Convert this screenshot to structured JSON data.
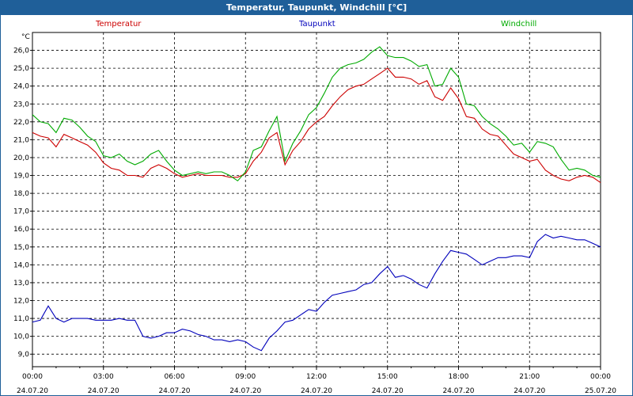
{
  "window": {
    "title": "Temperatur, Taupunkt, Windchill [°C]"
  },
  "legend": [
    {
      "name": "Temperatur",
      "color": "#cc0000"
    },
    {
      "name": "Taupunkt",
      "color": "#0000bb"
    },
    {
      "name": "Windchill",
      "color": "#00aa00"
    }
  ],
  "chart_data": {
    "type": "line",
    "ylabel": "°C",
    "ylim": [
      8.3,
      27.0
    ],
    "xlim_hours": [
      0,
      24
    ],
    "y_ticks": [
      "9,0",
      "10,0",
      "11,0",
      "12,0",
      "13,0",
      "14,0",
      "15,0",
      "16,0",
      "17,0",
      "18,0",
      "19,0",
      "20,0",
      "21,0",
      "22,0",
      "23,0",
      "24,0",
      "25,0",
      "26,0"
    ],
    "y_tick_values": [
      9,
      10,
      11,
      12,
      13,
      14,
      15,
      16,
      17,
      18,
      19,
      20,
      21,
      22,
      23,
      24,
      25,
      26
    ],
    "x_ticks": [
      {
        "time": "00:00",
        "date": "24.07.20"
      },
      {
        "time": "03:00",
        "date": "24.07.20"
      },
      {
        "time": "06:00",
        "date": "24.07.20"
      },
      {
        "time": "09:00",
        "date": "24.07.20"
      },
      {
        "time": "12:00",
        "date": "24.07.20"
      },
      {
        "time": "15:00",
        "date": "24.07.20"
      },
      {
        "time": "18:00",
        "date": "24.07.20"
      },
      {
        "time": "21:00",
        "date": "24.07.20"
      },
      {
        "time": "00:00",
        "date": "25.07.20"
      }
    ],
    "grid": true,
    "series": [
      {
        "name": "Temperatur",
        "color": "#cc0000",
        "x": [
          0,
          0.33,
          0.67,
          1,
          1.33,
          1.67,
          2,
          2.33,
          2.67,
          3,
          3.33,
          3.67,
          4,
          4.33,
          4.67,
          5,
          5.33,
          5.67,
          6,
          6.33,
          6.67,
          7,
          7.33,
          7.67,
          8,
          8.33,
          8.67,
          9,
          9.33,
          9.67,
          10,
          10.33,
          10.67,
          11,
          11.33,
          11.67,
          12,
          12.33,
          12.67,
          13,
          13.33,
          13.67,
          14,
          14.33,
          14.67,
          15,
          15.33,
          15.67,
          16,
          16.33,
          16.67,
          17,
          17.33,
          17.67,
          18,
          18.33,
          18.67,
          19,
          19.33,
          19.67,
          20,
          20.33,
          20.67,
          21,
          21.33,
          21.67,
          22,
          22.33,
          22.67,
          23,
          23.33,
          23.67,
          24
        ],
        "y": [
          21.4,
          21.2,
          21.1,
          20.6,
          21.3,
          21.1,
          20.9,
          20.7,
          20.3,
          19.7,
          19.4,
          19.3,
          19.0,
          19.0,
          18.9,
          19.4,
          19.6,
          19.4,
          19.1,
          18.9,
          19.0,
          19.1,
          19.0,
          19.0,
          19.0,
          18.9,
          18.9,
          19.1,
          19.8,
          20.3,
          21.1,
          21.4,
          19.6,
          20.4,
          20.9,
          21.6,
          22.0,
          22.3,
          22.9,
          23.4,
          23.8,
          24.0,
          24.1,
          24.4,
          24.7,
          25.0,
          24.5,
          24.5,
          24.4,
          24.1,
          24.3,
          23.4,
          23.2,
          23.9,
          23.3,
          22.3,
          22.2,
          21.6,
          21.3,
          21.2,
          20.7,
          20.2,
          20.0,
          19.8,
          19.9,
          19.3,
          19.0,
          18.8,
          18.7,
          18.9,
          19.0,
          18.9,
          18.6
        ]
      },
      {
        "name": "Taupunkt",
        "color": "#0000bb",
        "x": [
          0,
          0.33,
          0.67,
          1,
          1.33,
          1.67,
          2,
          2.33,
          2.67,
          3,
          3.33,
          3.67,
          4,
          4.33,
          4.67,
          5,
          5.33,
          5.67,
          6,
          6.33,
          6.67,
          7,
          7.33,
          7.67,
          8,
          8.33,
          8.67,
          9,
          9.33,
          9.67,
          10,
          10.33,
          10.67,
          11,
          11.33,
          11.67,
          12,
          12.33,
          12.67,
          13,
          13.33,
          13.67,
          14,
          14.33,
          14.67,
          15,
          15.33,
          15.67,
          16,
          16.33,
          16.67,
          17,
          17.33,
          17.67,
          18,
          18.33,
          18.67,
          19,
          19.33,
          19.67,
          20,
          20.33,
          20.67,
          21,
          21.33,
          21.67,
          22,
          22.33,
          22.67,
          23,
          23.33,
          23.67,
          24
        ],
        "y": [
          10.8,
          10.9,
          11.7,
          11.0,
          10.8,
          11.0,
          11.0,
          11.0,
          10.9,
          10.9,
          10.9,
          11.0,
          10.9,
          10.9,
          10.0,
          9.9,
          10.0,
          10.2,
          10.2,
          10.4,
          10.3,
          10.1,
          10.0,
          9.8,
          9.8,
          9.7,
          9.8,
          9.7,
          9.4,
          9.2,
          9.9,
          10.3,
          10.8,
          10.9,
          11.2,
          11.5,
          11.4,
          11.9,
          12.3,
          12.4,
          12.5,
          12.6,
          12.9,
          13.0,
          13.5,
          13.9,
          13.3,
          13.4,
          13.2,
          12.9,
          12.7,
          13.5,
          14.2,
          14.8,
          14.7,
          14.6,
          14.3,
          14.0,
          14.2,
          14.4,
          14.4,
          14.5,
          14.5,
          14.4,
          15.3,
          15.7,
          15.5,
          15.6,
          15.5,
          15.4,
          15.4,
          15.2,
          15.0
        ]
      },
      {
        "name": "Windchill",
        "color": "#00aa00",
        "x": [
          0,
          0.33,
          0.67,
          1,
          1.33,
          1.67,
          2,
          2.33,
          2.67,
          3,
          3.33,
          3.67,
          4,
          4.33,
          4.67,
          5,
          5.33,
          5.67,
          6,
          6.33,
          6.67,
          7,
          7.33,
          7.67,
          8,
          8.33,
          8.67,
          9,
          9.33,
          9.67,
          10,
          10.33,
          10.67,
          11,
          11.33,
          11.67,
          12,
          12.33,
          12.67,
          13,
          13.33,
          13.67,
          14,
          14.33,
          14.67,
          15,
          15.33,
          15.67,
          16,
          16.33,
          16.67,
          17,
          17.33,
          17.67,
          18,
          18.33,
          18.67,
          19,
          19.33,
          19.67,
          20,
          20.33,
          20.67,
          21,
          21.33,
          21.67,
          22,
          22.33,
          22.67,
          23,
          23.33,
          23.67,
          24
        ],
        "y": [
          22.4,
          22.0,
          21.9,
          21.4,
          22.2,
          22.1,
          21.7,
          21.2,
          20.9,
          20.1,
          20.0,
          20.2,
          19.8,
          19.6,
          19.8,
          20.2,
          20.4,
          19.8,
          19.3,
          19.0,
          19.1,
          19.2,
          19.1,
          19.2,
          19.2,
          19.0,
          18.7,
          19.2,
          20.4,
          20.6,
          21.5,
          22.3,
          19.8,
          20.8,
          21.5,
          22.4,
          22.8,
          23.6,
          24.5,
          25.0,
          25.2,
          25.3,
          25.5,
          25.9,
          26.2,
          25.7,
          25.6,
          25.6,
          25.4,
          25.1,
          25.2,
          24.0,
          24.1,
          25.0,
          24.5,
          23.0,
          22.9,
          22.3,
          21.9,
          21.6,
          21.2,
          20.7,
          20.8,
          20.3,
          20.9,
          20.8,
          20.6,
          19.9,
          19.3,
          19.4,
          19.3,
          19.0,
          18.9
        ]
      }
    ]
  }
}
